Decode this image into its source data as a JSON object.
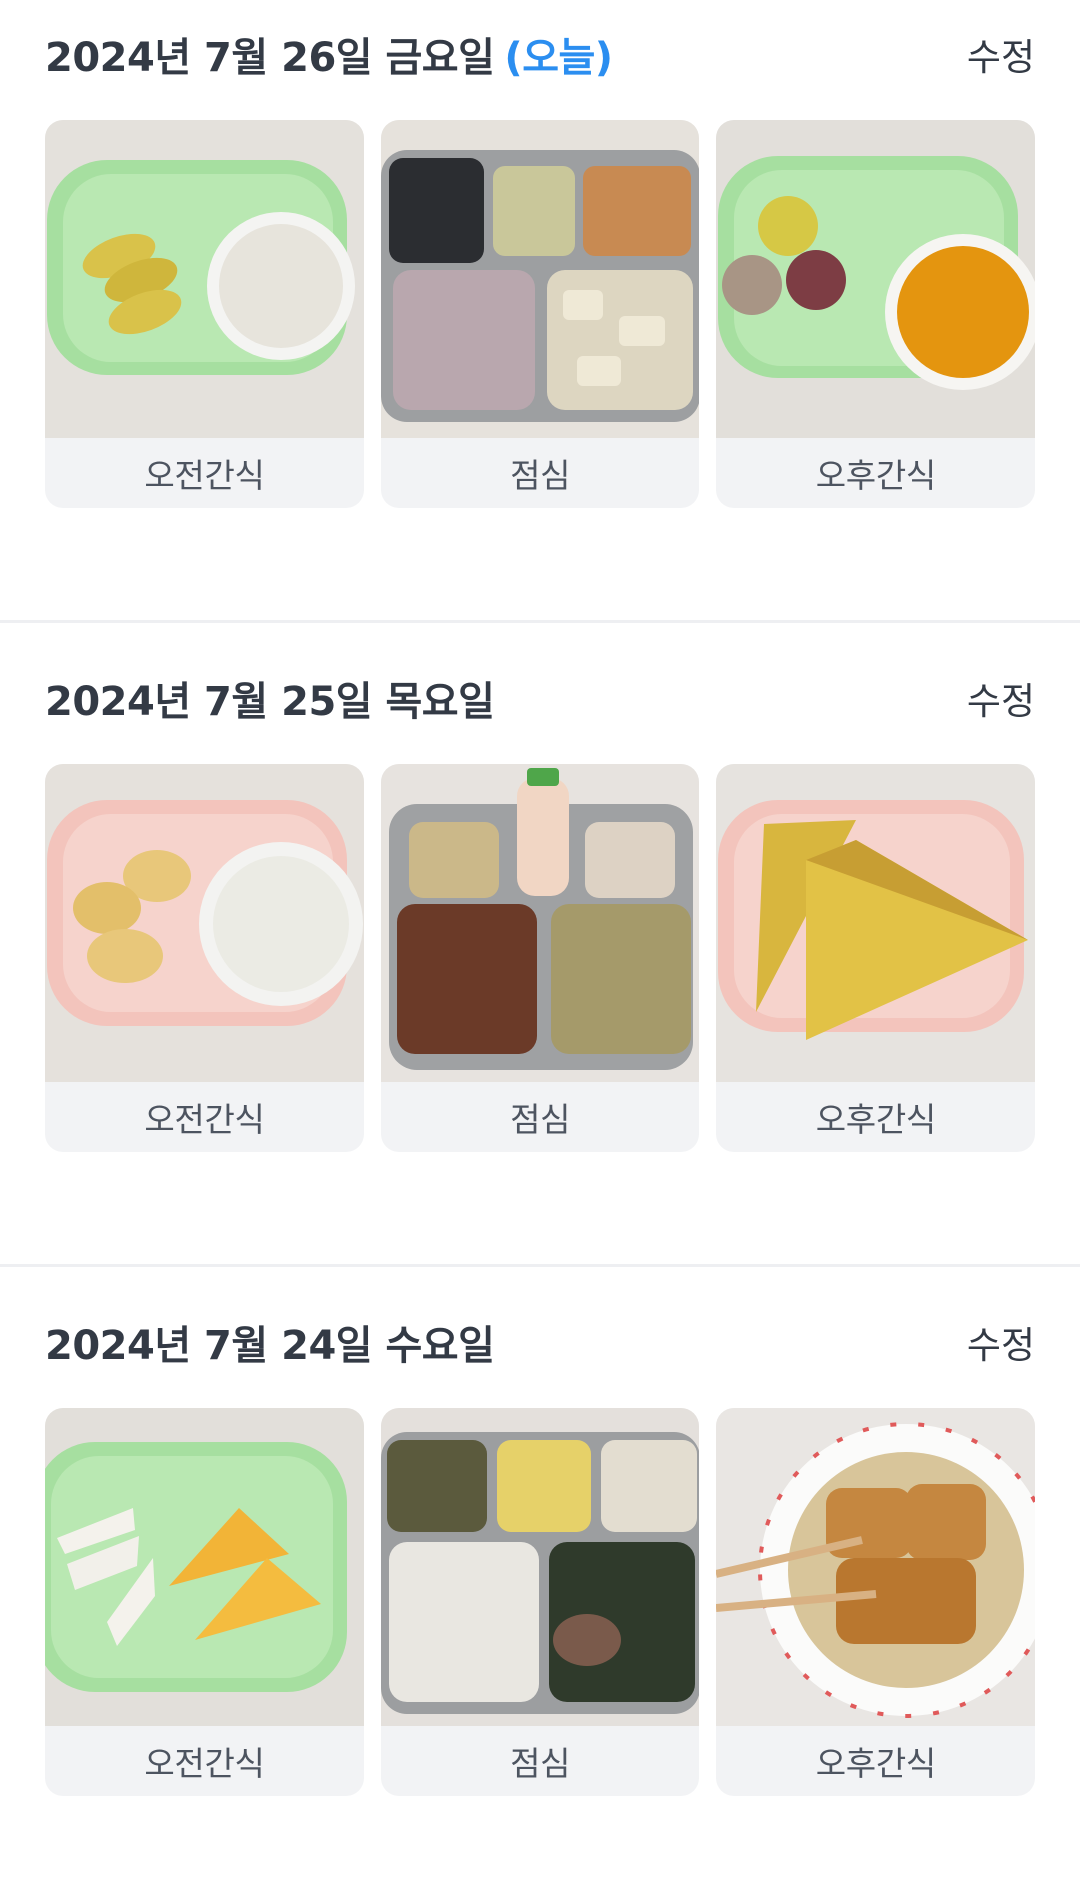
{
  "days": [
    {
      "title": "2024년 7월 26일 금요일",
      "today_label": "(오늘)",
      "edit_label": "수정",
      "meals": [
        {
          "label": "오전간식",
          "photo": "kiwi-and-milk-photo"
        },
        {
          "label": "점심",
          "photo": "rice-and-side-dishes-tray-photo"
        },
        {
          "label": "오후간식",
          "photo": "rice-cakes-and-juice-photo"
        }
      ]
    },
    {
      "title": "2024년 7월 25일 목요일",
      "edit_label": "수정",
      "meals": [
        {
          "label": "오전간식",
          "photo": "banana-and-milk-photo"
        },
        {
          "label": "점심",
          "photo": "lunch-tray-with-yogurt-drink-photo"
        },
        {
          "label": "오후간식",
          "photo": "french-toast-photo"
        }
      ]
    },
    {
      "title": "2024년 7월 24일 수요일",
      "edit_label": "수정",
      "meals": [
        {
          "label": "오전간식",
          "photo": "pear-and-cheese-photo"
        },
        {
          "label": "점심",
          "photo": "rice-and-seaweed-soup-tray-photo"
        },
        {
          "label": "오후간식",
          "photo": "fish-cake-soup-photo"
        }
      ]
    }
  ],
  "colors": {
    "text": "#333a45",
    "accent": "#2b8ef0",
    "card_bg": "#f2f3f5",
    "divider": "#eeeff2",
    "plate_green": "#a6dfa0",
    "plate_pink": "#f3c4bc"
  }
}
